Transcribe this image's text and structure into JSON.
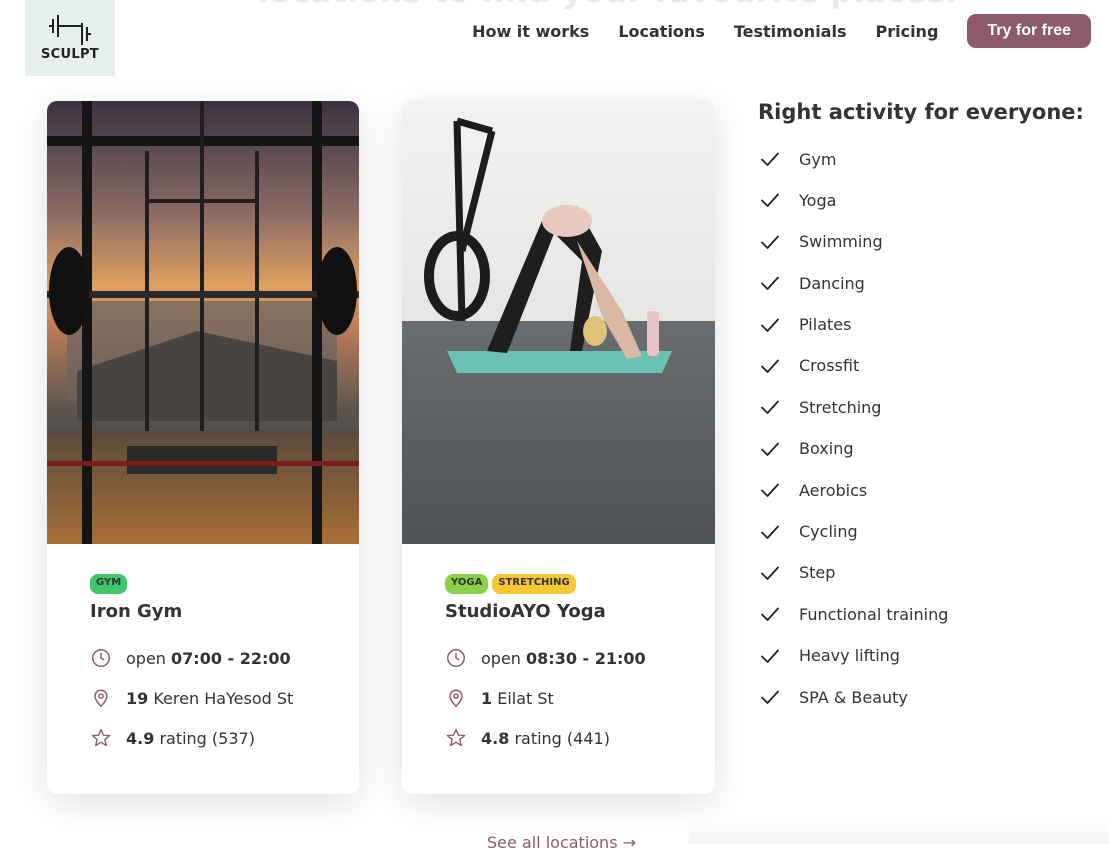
{
  "background_heading": "locations to find your favourite places.",
  "logo": {
    "text": "SCULPT"
  },
  "nav": {
    "items": [
      "How it works",
      "Locations",
      "Testimonials",
      "Pricing"
    ],
    "cta_label": "Try for free"
  },
  "locations": [
    {
      "tags": [
        "GYM"
      ],
      "name": "Iron Gym",
      "hours_prefix": "open",
      "hours": "07:00 - 22:00",
      "address_number": "19",
      "address_street": "Keren HaYesod St",
      "rating": "4.9",
      "rating_label": "rating (537)"
    },
    {
      "tags": [
        "YOGA",
        "STRETCHING"
      ],
      "name": "StudioAYO Yoga",
      "hours_prefix": "open",
      "hours": "08:30 - 21:00",
      "address_number": "1",
      "address_street": "Eilat St",
      "rating": "4.8",
      "rating_label": "rating (441)"
    }
  ],
  "activities": {
    "title": "Right activity for everyone:",
    "items": [
      "Gym",
      "Yoga",
      "Swimming",
      "Dancing",
      "Pilates",
      "Crossfit",
      "Stretching",
      "Boxing",
      "Aerobics",
      "Cycling",
      "Step",
      "Functional training",
      "Heavy lifting",
      "SPA & Beauty"
    ]
  },
  "see_all_label": "See all locations →",
  "colors": {
    "accent": "#8c5a6a",
    "logo_bg": "#e6efee",
    "tag_gym": "#3fc66b",
    "tag_yoga": "#8ad14b",
    "tag_stretching": "#f5c734"
  },
  "icons": [
    "barbell-logo-icon",
    "clock-icon",
    "map-pin-icon",
    "star-icon",
    "checkmark-icon"
  ]
}
